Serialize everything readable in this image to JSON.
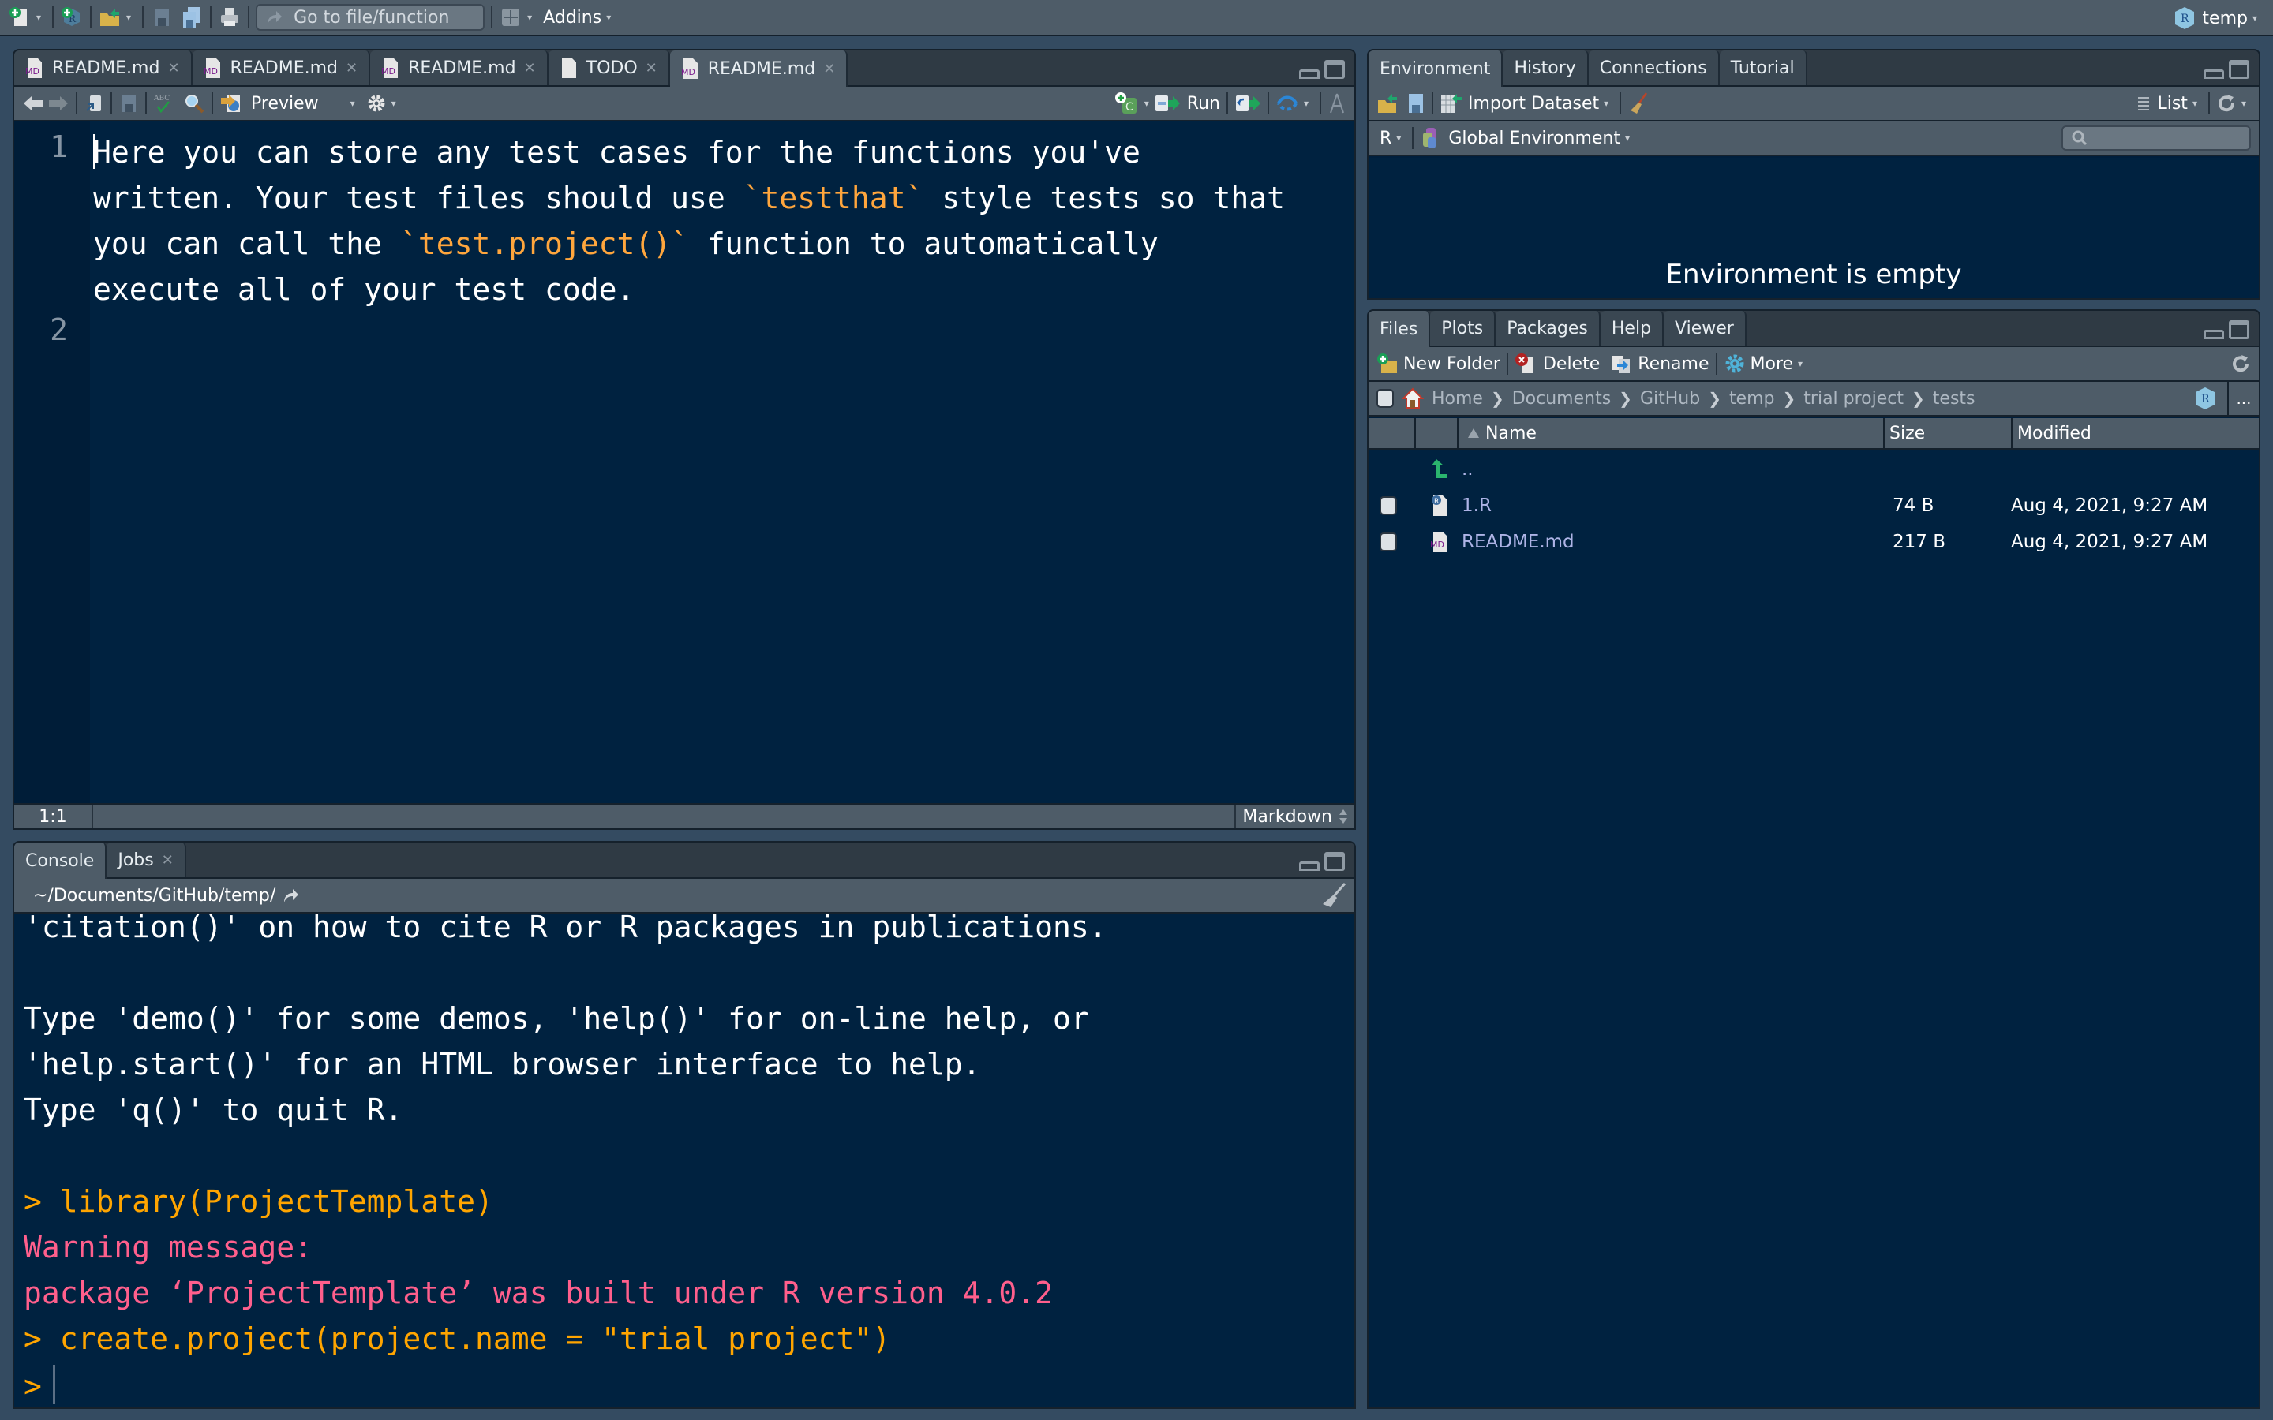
{
  "main_toolbar": {
    "goto_placeholder": "Go to file/function",
    "addins_label": "Addins",
    "project_label": "temp"
  },
  "editor": {
    "tabs": [
      {
        "label": "README.md",
        "icon": "md-file-icon",
        "active": false
      },
      {
        "label": "README.md",
        "icon": "md-file-icon",
        "active": false
      },
      {
        "label": "README.md",
        "icon": "md-file-icon",
        "active": false
      },
      {
        "label": "TODO",
        "icon": "text-file-icon",
        "active": false
      },
      {
        "label": "README.md",
        "icon": "md-file-icon",
        "active": true
      }
    ],
    "toolbar": {
      "preview_label": "Preview",
      "run_label": "Run"
    },
    "lines": [
      {
        "number": "1",
        "segments": [
          {
            "text": "Here you can store any test cases for the functions you've\nwritten. Your test files should use ",
            "hl": false
          },
          {
            "text": "`testthat`",
            "hl": true
          },
          {
            "text": " style tests so that\nyou can call the ",
            "hl": false
          },
          {
            "text": "`test.project()`",
            "hl": true
          },
          {
            "text": " function to automatically\nexecute all of your test code.",
            "hl": false
          }
        ]
      },
      {
        "number": "2",
        "segments": []
      }
    ],
    "status": {
      "cursor_position": "1:1",
      "file_type": "Markdown"
    }
  },
  "console": {
    "tabs": [
      {
        "label": "Console",
        "active": true
      },
      {
        "label": "Jobs",
        "active": false,
        "closable": true
      }
    ],
    "working_dir": "~/Documents/GitHub/temp/",
    "lines": [
      {
        "text": "'citation()' on how to cite R or R packages in publications.",
        "type": "output"
      },
      {
        "text": "",
        "type": "output"
      },
      {
        "text": "Type 'demo()' for some demos, 'help()' for on-line help, or",
        "type": "output"
      },
      {
        "text": "'help.start()' for an HTML browser interface to help.",
        "type": "output"
      },
      {
        "text": "Type 'q()' to quit R.",
        "type": "output"
      },
      {
        "text": "",
        "type": "output"
      },
      {
        "text": "> library(ProjectTemplate)",
        "type": "command"
      },
      {
        "text": "Warning message:",
        "type": "warning"
      },
      {
        "text": "package ‘ProjectTemplate’ was built under R version 4.0.2",
        "type": "warning"
      },
      {
        "text": "> create.project(project.name = \"trial project\")",
        "type": "command"
      }
    ],
    "prompt": ">"
  },
  "environment": {
    "tabs": [
      {
        "label": "Environment",
        "active": true
      },
      {
        "label": "History",
        "active": false
      },
      {
        "label": "Connections",
        "active": false
      },
      {
        "label": "Tutorial",
        "active": false
      }
    ],
    "toolbar": {
      "import_label": "Import Dataset",
      "view_mode": "List"
    },
    "language": "R",
    "scope": "Global Environment",
    "search_placeholder": "",
    "empty_message": "Environment is empty"
  },
  "files": {
    "tabs": [
      {
        "label": "Files",
        "active": true
      },
      {
        "label": "Plots",
        "active": false
      },
      {
        "label": "Packages",
        "active": false
      },
      {
        "label": "Help",
        "active": false
      },
      {
        "label": "Viewer",
        "active": false
      }
    ],
    "toolbar": {
      "new_folder": "New Folder",
      "delete": "Delete",
      "rename": "Rename",
      "more": "More"
    },
    "breadcrumb": [
      "Home",
      "Documents",
      "GitHub",
      "temp",
      "trial project",
      "tests"
    ],
    "more_label": "...",
    "columns": {
      "name": "Name",
      "size": "Size",
      "modified": "Modified"
    },
    "parent_label": "..",
    "rows": [
      {
        "name": "1.R",
        "icon": "r-file-icon",
        "size": "74 B",
        "modified": "Aug 4, 2021, 9:27 AM"
      },
      {
        "name": "README.md",
        "icon": "md-file-icon",
        "size": "217 B",
        "modified": "Aug 4, 2021, 9:27 AM"
      }
    ]
  },
  "colors": {
    "editor_bg": "#002240",
    "chrome": "#4e5c68",
    "string_highlight": "#ffa63d",
    "console_command": "#ffa500",
    "console_warning": "#ff5f8c",
    "file_link": "#aeb4e6"
  }
}
